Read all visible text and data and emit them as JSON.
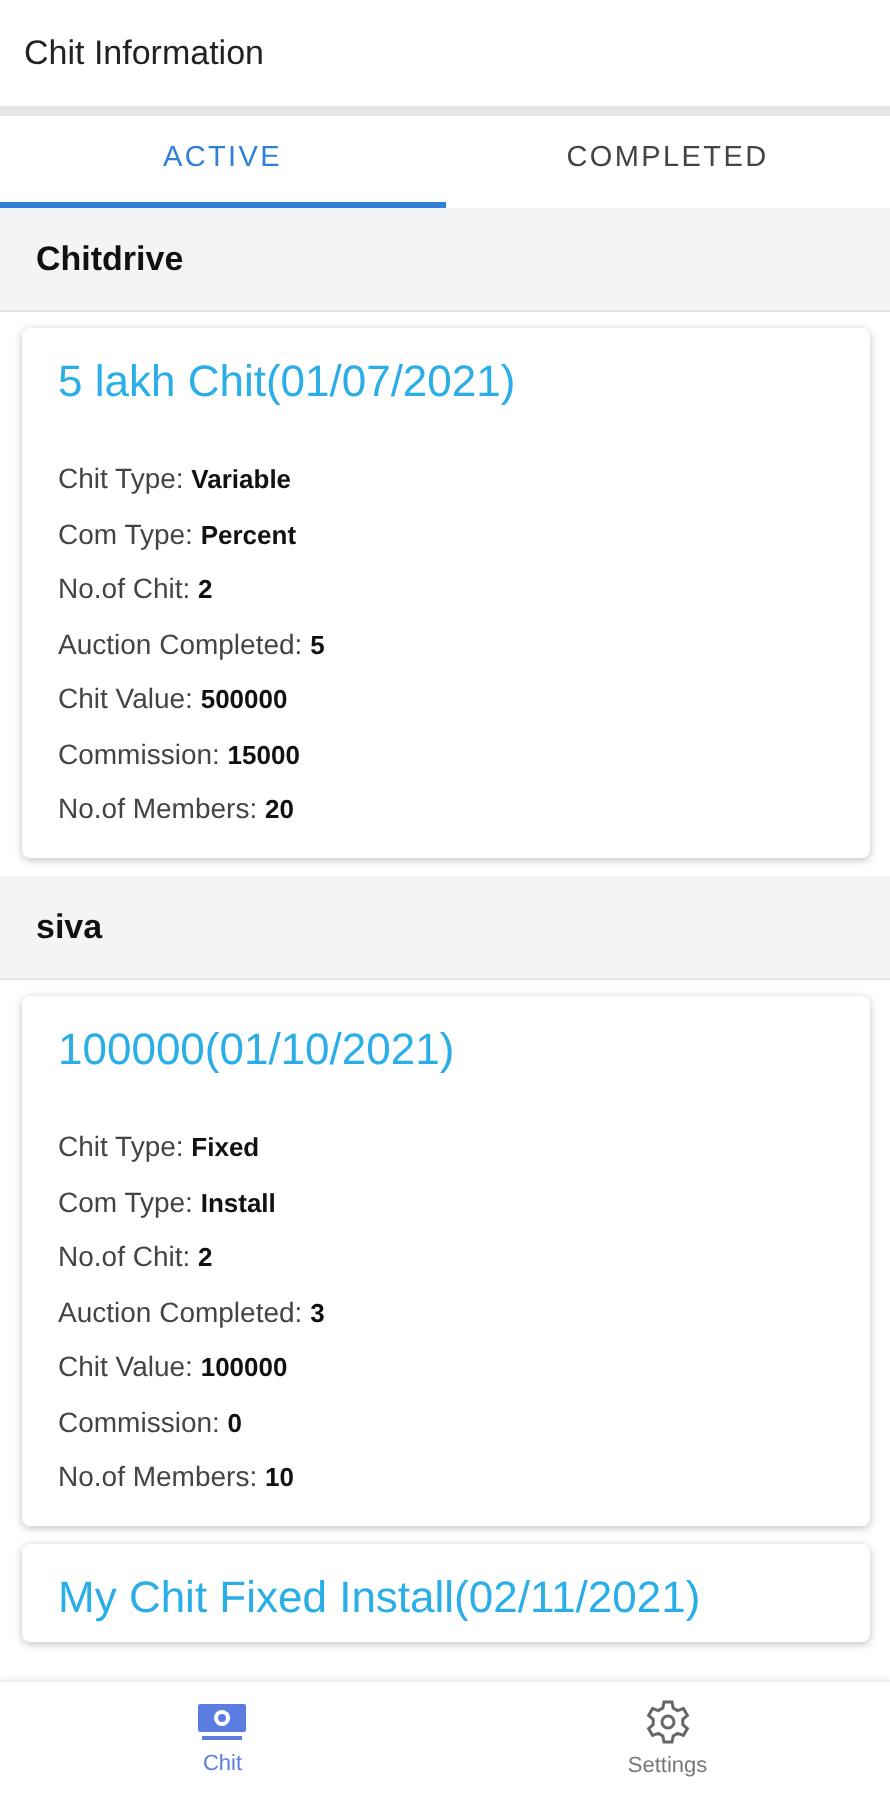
{
  "header": {
    "title": "Chit Information"
  },
  "tabs": [
    {
      "label": "ACTIVE",
      "selected": true
    },
    {
      "label": "COMPLETED",
      "selected": false
    }
  ],
  "groups": [
    {
      "name": "Chitdrive",
      "chits": [
        {
          "title": "5 lakh Chit(01/07/2021)",
          "fields": [
            {
              "label": "Chit Type:",
              "value": "Variable"
            },
            {
              "label": "Com Type:",
              "value": "Percent"
            },
            {
              "label": "No.of Chit:",
              "value": "2"
            },
            {
              "label": "Auction Completed:",
              "value": "5"
            },
            {
              "label": "Chit Value:",
              "value": "500000"
            },
            {
              "label": "Commission:",
              "value": "15000"
            },
            {
              "label": "No.of Members:",
              "value": "20"
            }
          ]
        }
      ]
    },
    {
      "name": "siva",
      "chits": [
        {
          "title": "100000(01/10/2021)",
          "fields": [
            {
              "label": "Chit Type:",
              "value": "Fixed"
            },
            {
              "label": "Com Type:",
              "value": "Install"
            },
            {
              "label": "No.of Chit:",
              "value": "2"
            },
            {
              "label": "Auction Completed:",
              "value": "3"
            },
            {
              "label": "Chit Value:",
              "value": "100000"
            },
            {
              "label": "Commission:",
              "value": "0"
            },
            {
              "label": "No.of Members:",
              "value": "10"
            }
          ]
        },
        {
          "title": "My Chit Fixed Install(02/11/2021)"
        }
      ]
    }
  ],
  "bottom_nav": [
    {
      "kind": "chit",
      "label": "Chit",
      "selected": true
    },
    {
      "kind": "settings",
      "label": "Settings",
      "selected": false
    }
  ]
}
